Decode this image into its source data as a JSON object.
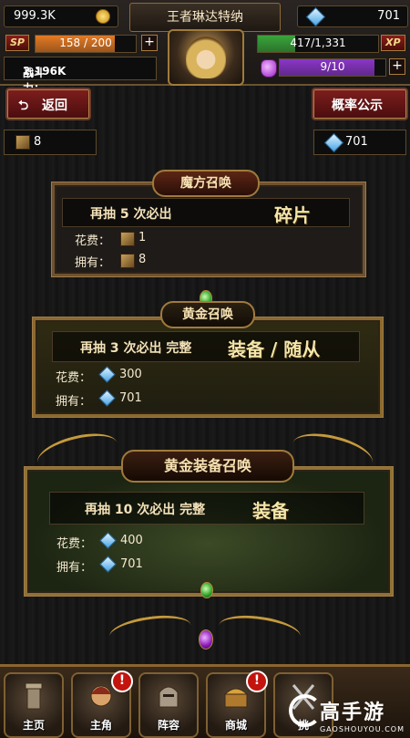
{
  "status": {
    "gold": "999.3K",
    "player_name": "王者琳达特纳",
    "gems": "701",
    "sp_label": "SP",
    "sp_value": "158 / 200",
    "sp_fill": 0.79,
    "power_label": "战斗力：",
    "power_value": "2,196K",
    "xp_value": "417/1,331",
    "xp_label": "XP",
    "xp_fill": 0.31,
    "energy_value": "9/10",
    "energy_fill": 0.9
  },
  "actions": {
    "back_label": "返回",
    "probability_label": "概率公示"
  },
  "resources": {
    "box_count": "8",
    "gem_count": "701"
  },
  "summons": [
    {
      "title": "魔方召唤",
      "hint_prefix": "再抽  5  次必出",
      "hint_reward": "碎片",
      "cost_label": "花费：",
      "cost_value": "1",
      "own_label": "拥有：",
      "own_value": "8"
    },
    {
      "title": "黄金召唤",
      "hint_prefix": "再抽  3  次必出 完整",
      "hint_reward": "装备 / 随从",
      "cost_label": "花费：",
      "cost_value": "300",
      "own_label": "拥有：",
      "own_value": "701"
    },
    {
      "title": "黄金装备召唤",
      "hint_prefix": "再抽 10 次必出 完整",
      "hint_reward": "装备",
      "cost_label": "花费：",
      "cost_value": "400",
      "own_label": "拥有：",
      "own_value": "701"
    }
  ],
  "nav": [
    {
      "label": "主页",
      "alert": ""
    },
    {
      "label": "主角",
      "alert": "!"
    },
    {
      "label": "阵容",
      "alert": ""
    },
    {
      "label": "商城",
      "alert": "!"
    },
    {
      "label": "挑",
      "alert": ""
    }
  ],
  "watermark": {
    "brand": "高手游",
    "url": "GAOSHOUYOU.COM"
  },
  "colors": {
    "sp_bar": "#e37a24",
    "xp_bar": "#3aa53a",
    "energy_bar": "#8a36c8",
    "accent_gold": "#c59a3c"
  }
}
